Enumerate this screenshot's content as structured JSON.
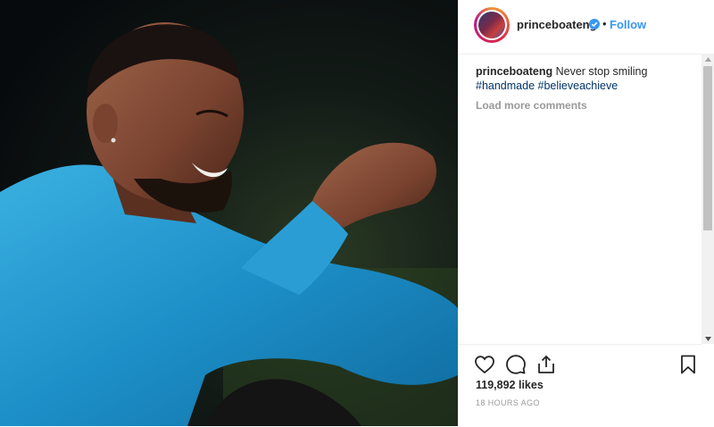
{
  "post": {
    "username": "princeboateng",
    "follow_label": "Follow",
    "separator": "•",
    "caption_text": "Never stop smiling",
    "hashtags": [
      "#handmade",
      "#believeachieve"
    ],
    "load_more": "Load more comments",
    "likes": "119,892 likes",
    "timestamp": "18 HOURS AGO"
  },
  "icons": {
    "verified": "verified-badge-icon",
    "like": "heart-icon",
    "comment": "comment-bubble-icon",
    "share": "share-icon",
    "save": "bookmark-icon"
  },
  "colors": {
    "link": "#3897f0",
    "hashtag": "#003569",
    "muted": "#999999",
    "text": "#262626"
  }
}
